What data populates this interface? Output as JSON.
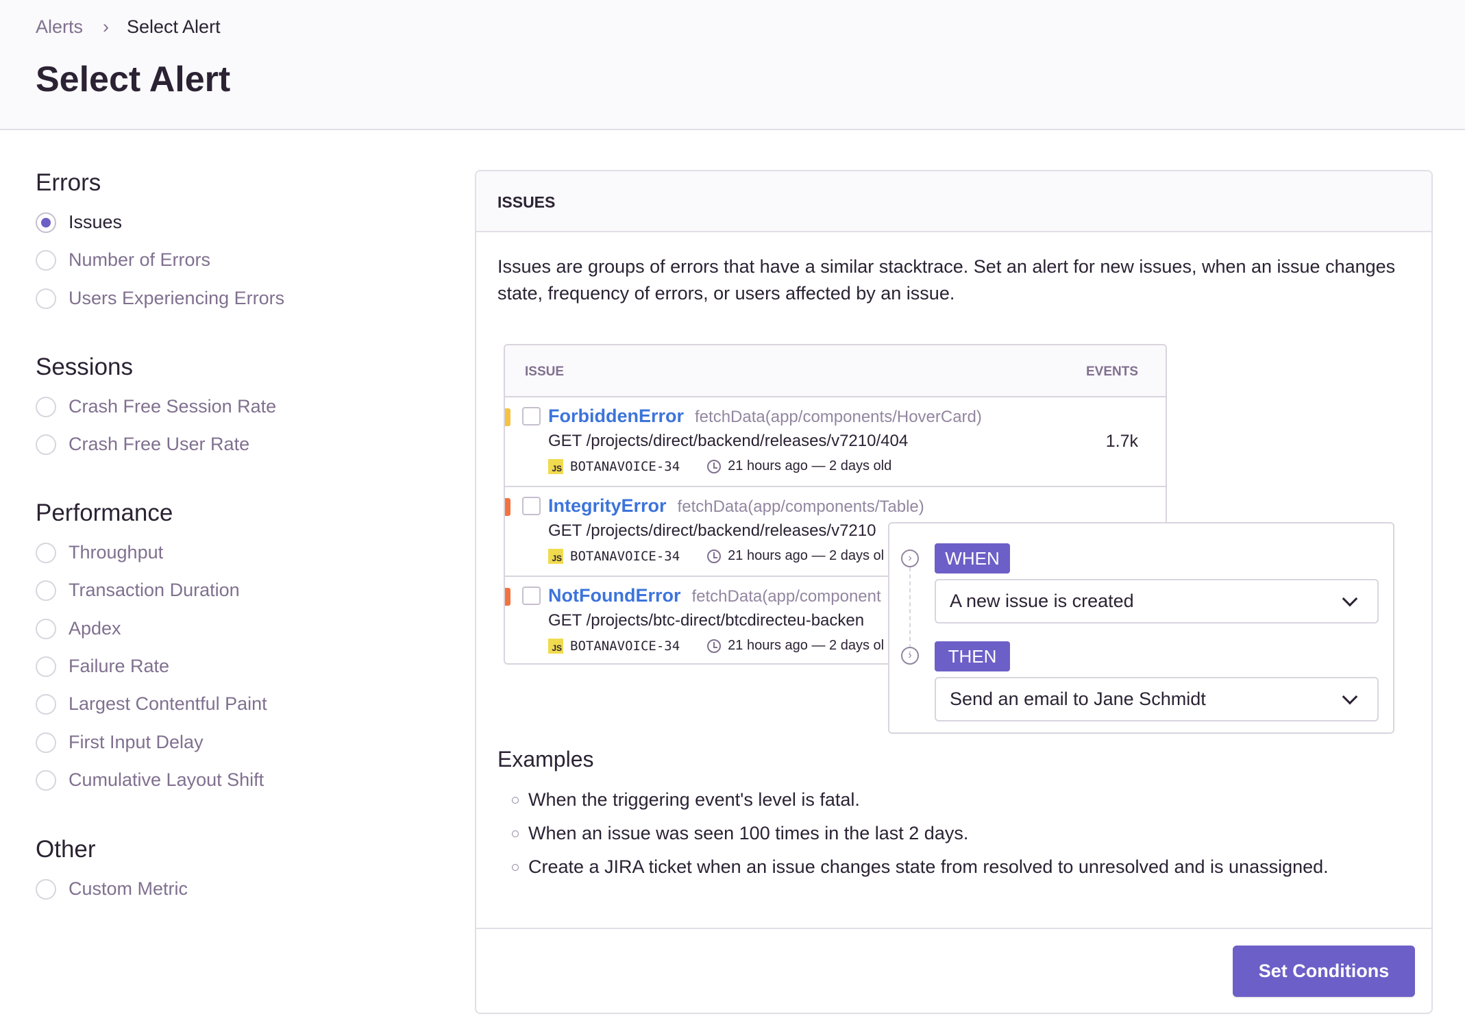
{
  "breadcrumb": {
    "items": [
      "Alerts",
      "Select Alert"
    ]
  },
  "page_title": "Select Alert",
  "sidebar": {
    "sections": [
      {
        "title": "Errors",
        "items": [
          {
            "label": "Issues",
            "selected": true
          },
          {
            "label": "Number of Errors"
          },
          {
            "label": "Users Experiencing Errors"
          }
        ]
      },
      {
        "title": "Sessions",
        "items": [
          {
            "label": "Crash Free Session Rate"
          },
          {
            "label": "Crash Free User Rate"
          }
        ]
      },
      {
        "title": "Performance",
        "items": [
          {
            "label": "Throughput"
          },
          {
            "label": "Transaction Duration"
          },
          {
            "label": "Apdex"
          },
          {
            "label": "Failure Rate"
          },
          {
            "label": "Largest Contentful Paint"
          },
          {
            "label": "First Input Delay"
          },
          {
            "label": "Cumulative Layout Shift"
          }
        ]
      },
      {
        "title": "Other",
        "items": [
          {
            "label": "Custom Metric"
          }
        ]
      }
    ]
  },
  "panel": {
    "header": "ISSUES",
    "description": "Issues are groups of errors that have a similar stacktrace. Set an alert for new issues, when an issue changes state, frequency of errors, or users affected by an issue.",
    "table": {
      "columns": [
        "ISSUE",
        "EVENTS"
      ],
      "rows": [
        {
          "title": "ForbiddenError",
          "culprit": "fetchData(app/components/HoverCard)",
          "message": "GET /projects/direct/backend/releases/v7210/404",
          "project": "BOTANAVOICE-34",
          "platform": "JS",
          "time": "21 hours ago — 2 days old",
          "events": "1.7k",
          "level_color": "#f5c343"
        },
        {
          "title": "IntegrityError",
          "culprit": "fetchData(app/components/Table)",
          "message": "GET /projects/direct/backend/releases/v7210",
          "project": "BOTANAVOICE-34",
          "platform": "JS",
          "time": "21 hours ago — 2 days ol",
          "events": "",
          "level_color": "#f2733f"
        },
        {
          "title": "NotFoundError",
          "culprit": "fetchData(app/component",
          "message": "GET /projects/btc-direct/btcdirecteu-backen",
          "project": "BOTANAVOICE-34",
          "platform": "JS",
          "time": "21 hours ago — 2 days ol",
          "events": "",
          "level_color": "#f2733f"
        }
      ]
    },
    "rule": {
      "when_label": "WHEN",
      "when_value": "A new issue is created",
      "then_label": "THEN",
      "then_value": "Send an email to Jane Schmidt"
    },
    "examples_title": "Examples",
    "examples": [
      "When the triggering event's level is fatal.",
      "When an issue was seen 100 times in the last 2 days.",
      "Create a JIRA ticket when an issue changes state from resolved to unresolved and is unassigned."
    ],
    "button": "Set Conditions"
  },
  "colors": {
    "accent": "#6c5fc7",
    "link": "#3d74db",
    "warning": "#f5c343",
    "error": "#f2733f"
  }
}
